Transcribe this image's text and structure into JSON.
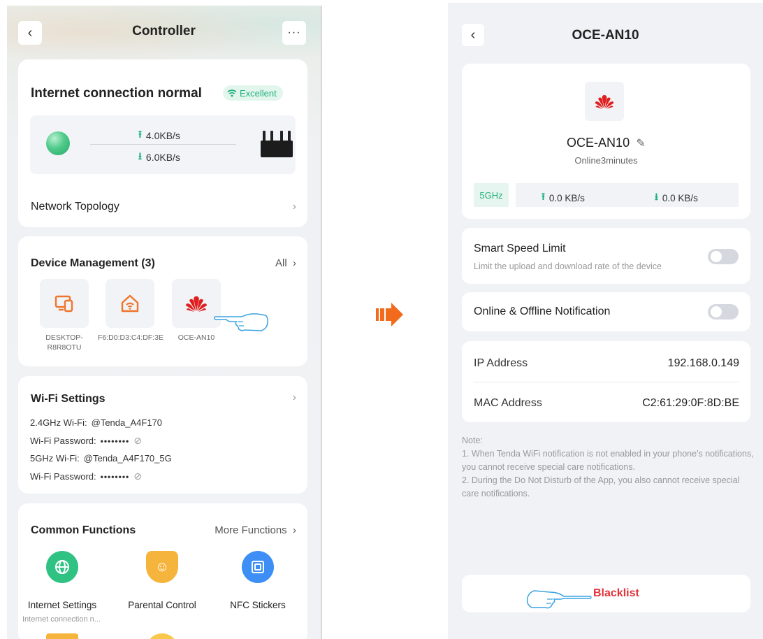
{
  "left": {
    "title": "Controller",
    "connection": {
      "title": "Internet connection normal",
      "quality": "Excellent",
      "upload": "4.0KB/s",
      "download": "6.0KB/s",
      "topology_label": "Network Topology"
    },
    "devices": {
      "title": "Device Management (3)",
      "all_label": "All",
      "items": [
        {
          "name": "DESKTOP-R8R8OTU",
          "icon": "computer-icon"
        },
        {
          "name": "F6:D0:D3:C4:DF:3E",
          "icon": "home-wifi-icon"
        },
        {
          "name": "OCE-AN10",
          "icon": "huawei-logo"
        }
      ]
    },
    "wifi": {
      "title": "Wi-Fi Settings",
      "ssid24_label": "2.4GHz Wi-Fi:",
      "ssid24": "@Tenda_A4F170",
      "pwd_label": "Wi-Fi Password:",
      "pwd_mask": "••••••••",
      "ssid5_label": "5GHz Wi-Fi:",
      "ssid5": "@Tenda_A4F170_5G"
    },
    "functions": {
      "title": "Common Functions",
      "more_label": "More Functions",
      "items": [
        {
          "label": "Internet Settings",
          "sub": "Internet connection n...",
          "icon": "globe-icon",
          "color": "#2fc283"
        },
        {
          "label": "Parental Control",
          "sub": "",
          "icon": "child-shield-icon",
          "color": "#f5b53d"
        },
        {
          "label": "NFC Stickers",
          "sub": "",
          "icon": "nfc-icon",
          "color": "#3d8ff5"
        }
      ]
    }
  },
  "right": {
    "title": "OCE-AN10",
    "device_name": "OCE-AN10",
    "online": "Online3minutes",
    "band": "5GHz",
    "upload": "0.0 KB/s",
    "download": "0.0 KB/s",
    "smart_limit": {
      "label": "Smart Speed Limit",
      "sub": "Limit the upload and download rate of the device"
    },
    "notification_label": "Online & Offline Notification",
    "ip_label": "IP Address",
    "ip_value": "192.168.0.149",
    "mac_label": "MAC Address",
    "mac_value": "C2:61:29:0F:8D:BE",
    "note": {
      "title": "Note:",
      "line1": "1. When Tenda WiFi notification is not enabled in your phone's notifications, you cannot receive special care notifications.",
      "line2": "2. During the Do Not Disturb of the App, you also cannot receive special care notifications."
    },
    "blacklist_label": "Blacklist"
  },
  "colors": {
    "accent_green": "#22b07d",
    "arrow_orange": "#f26a1b",
    "blacklist_red": "#e2323a",
    "hand_blue": "#3aa2e0"
  }
}
